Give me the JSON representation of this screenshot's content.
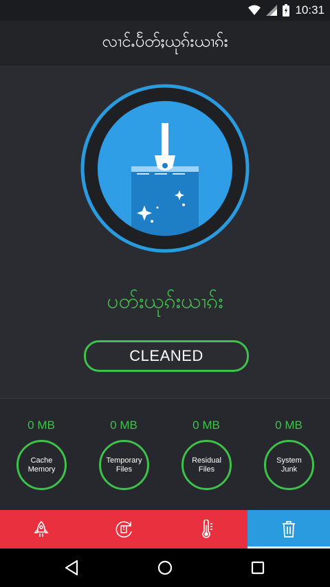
{
  "status_bar": {
    "time": "10:31"
  },
  "app_bar": {
    "title": "လၢင်ႉပႅတ်ႈယုၵ်းယၢၵ်း"
  },
  "hero": {
    "status_text": "ပတ်းယုၵ်းယၢၵ်း",
    "button_label": "CLEANED"
  },
  "stats": [
    {
      "size": "0 MB",
      "label": "Cache Memory"
    },
    {
      "size": "0 MB",
      "label": "Temporary Files"
    },
    {
      "size": "0 MB",
      "label": "Residual Files"
    },
    {
      "size": "0 MB",
      "label": "System Junk"
    }
  ],
  "bottom_tabs": [
    {
      "icon": "rocket-icon"
    },
    {
      "icon": "cpu-cooler-icon"
    },
    {
      "icon": "thermometer-icon"
    },
    {
      "icon": "trash-icon",
      "active": true
    }
  ],
  "colors": {
    "accent_green": "#3ec24a",
    "tab_red": "#e8303e",
    "tab_blue": "#2a9bdf",
    "background": "#26282d"
  }
}
